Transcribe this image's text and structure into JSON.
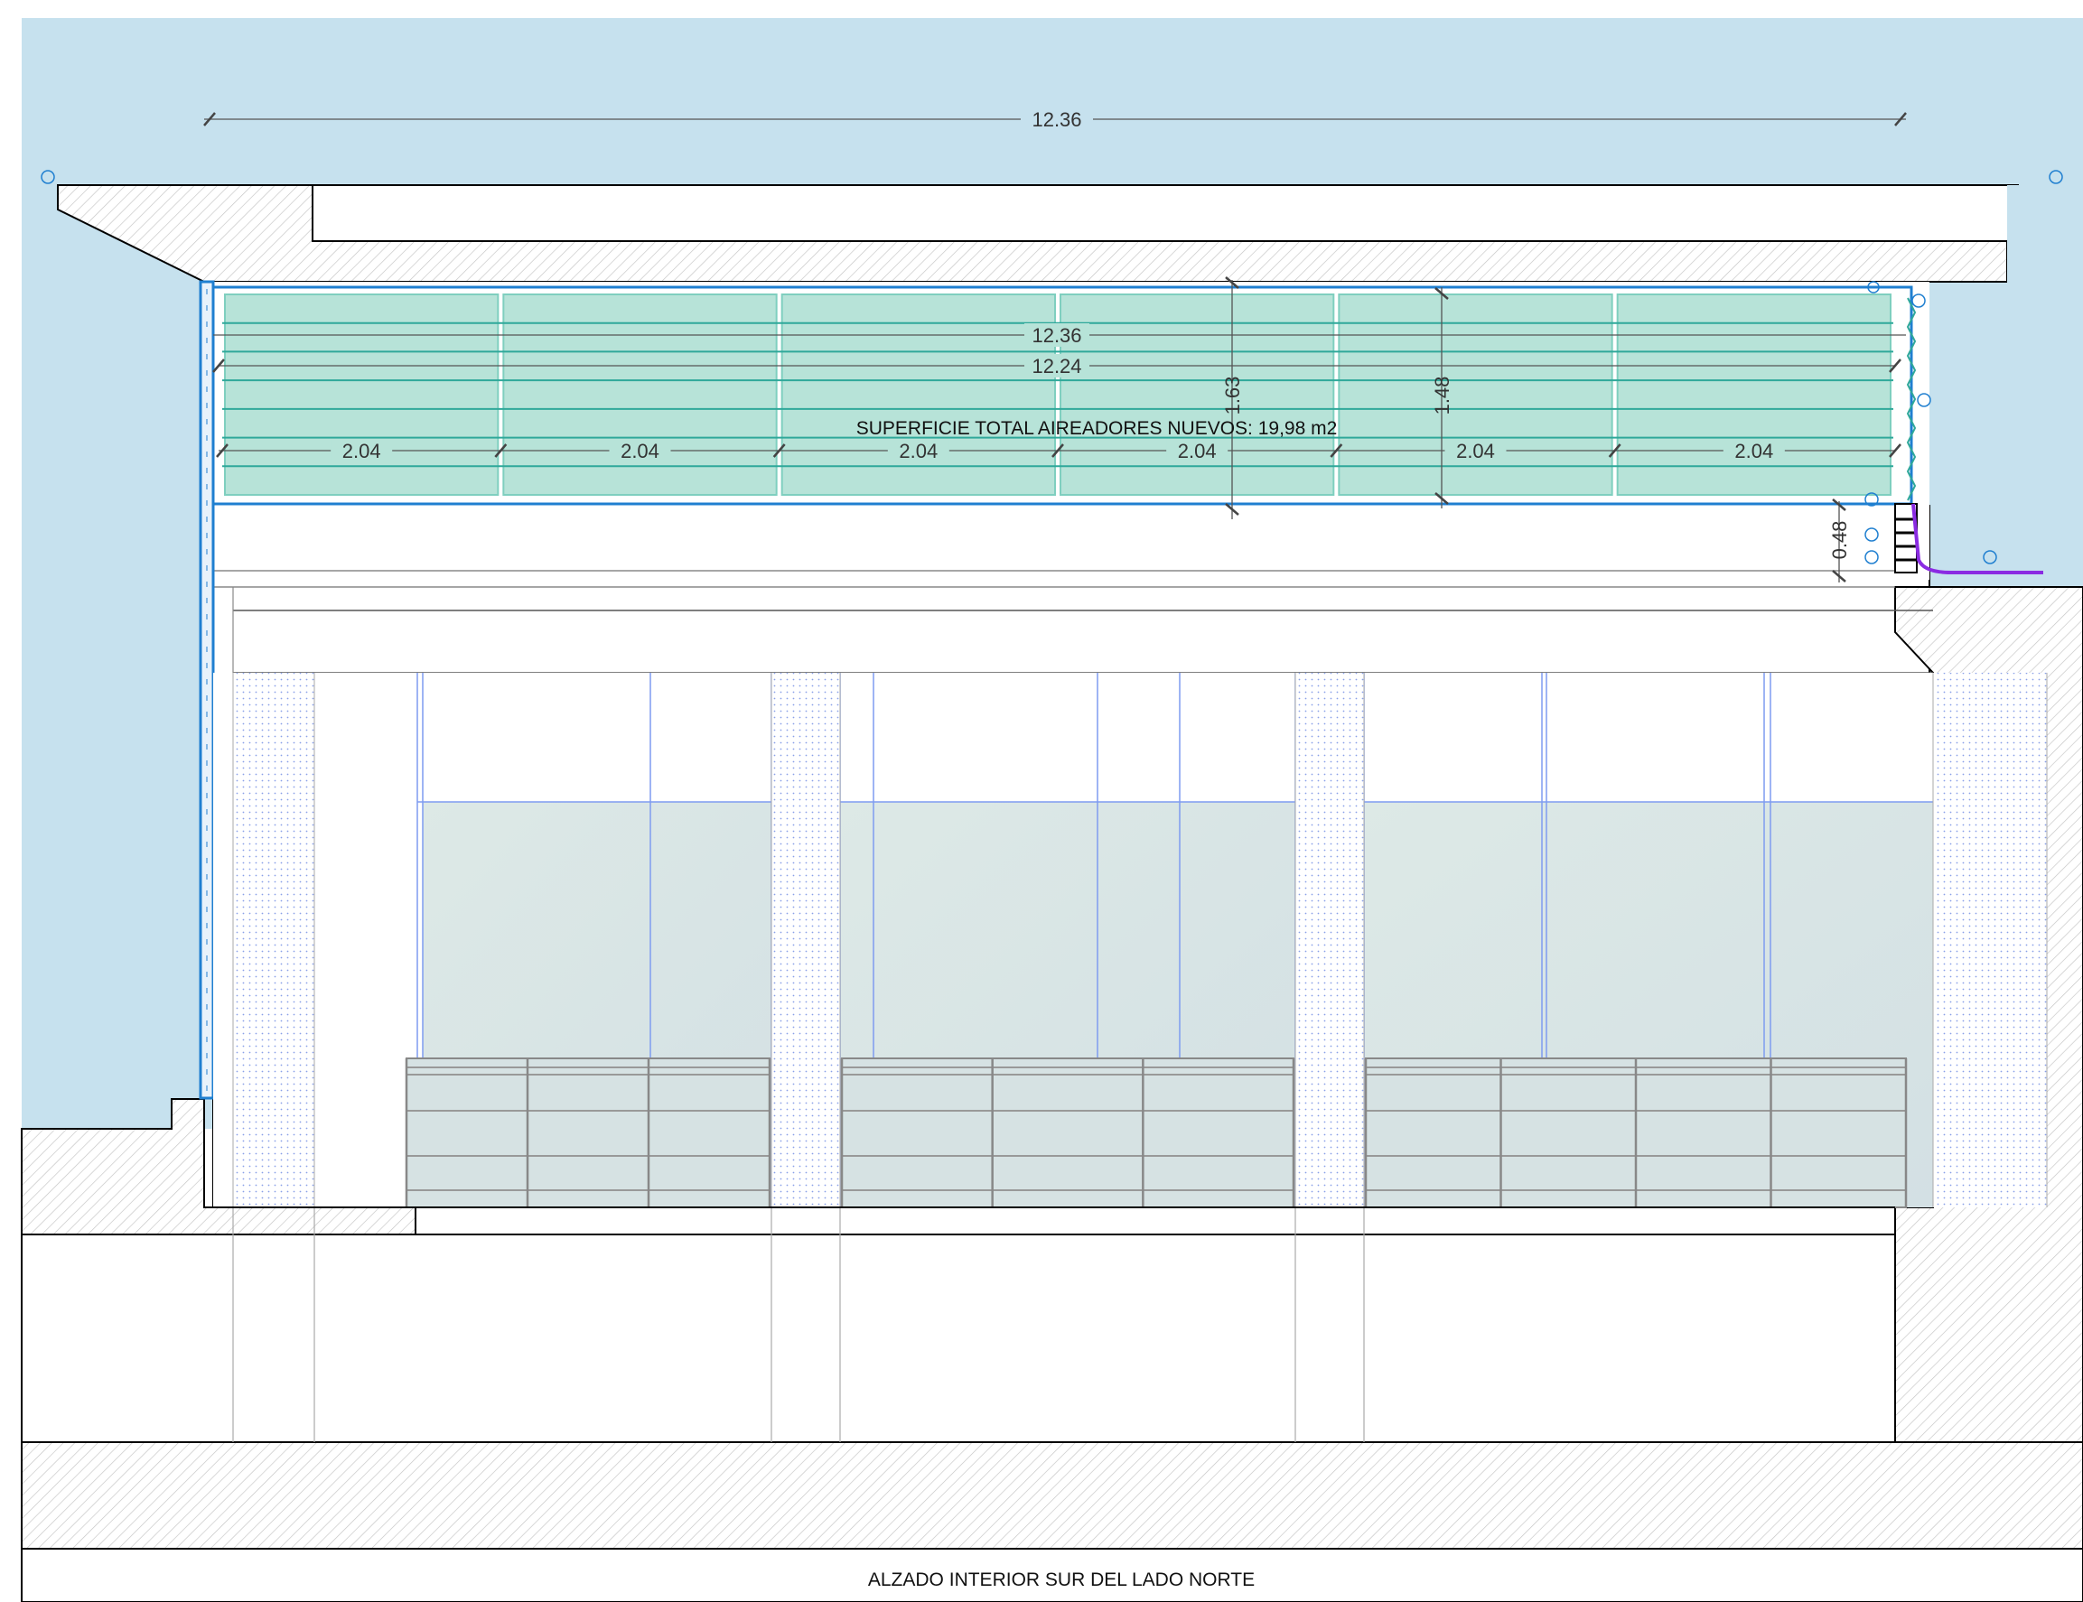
{
  "colors": {
    "sky": "#c6e1ee",
    "louver_fill": "#b7e3d8",
    "louver_line": "#2fa89a",
    "frame_blue": "#1f7fd0",
    "grid_blue": "#7f9cf0",
    "glass": "#d8e6e6",
    "purple": "#8a2be2",
    "concrete_hatch": "#b0b0b0",
    "outline": "#000000"
  },
  "drawing": {
    "title": "ALZADO INTERIOR SUR DEL LADO NORTE",
    "area_note": "SUPERFICIE TOTAL AIREADORES NUEVOS: 19,98 m2",
    "dims": {
      "overall_top": "12.36",
      "overall_louver": "12.36",
      "inner_louver": "12.24",
      "height_total": "1.63",
      "height_louver": "1.48",
      "gap_below": "0.48"
    },
    "module_widths": [
      "2.04",
      "2.04",
      "2.04",
      "2.04",
      "2.04",
      "2.04"
    ]
  }
}
